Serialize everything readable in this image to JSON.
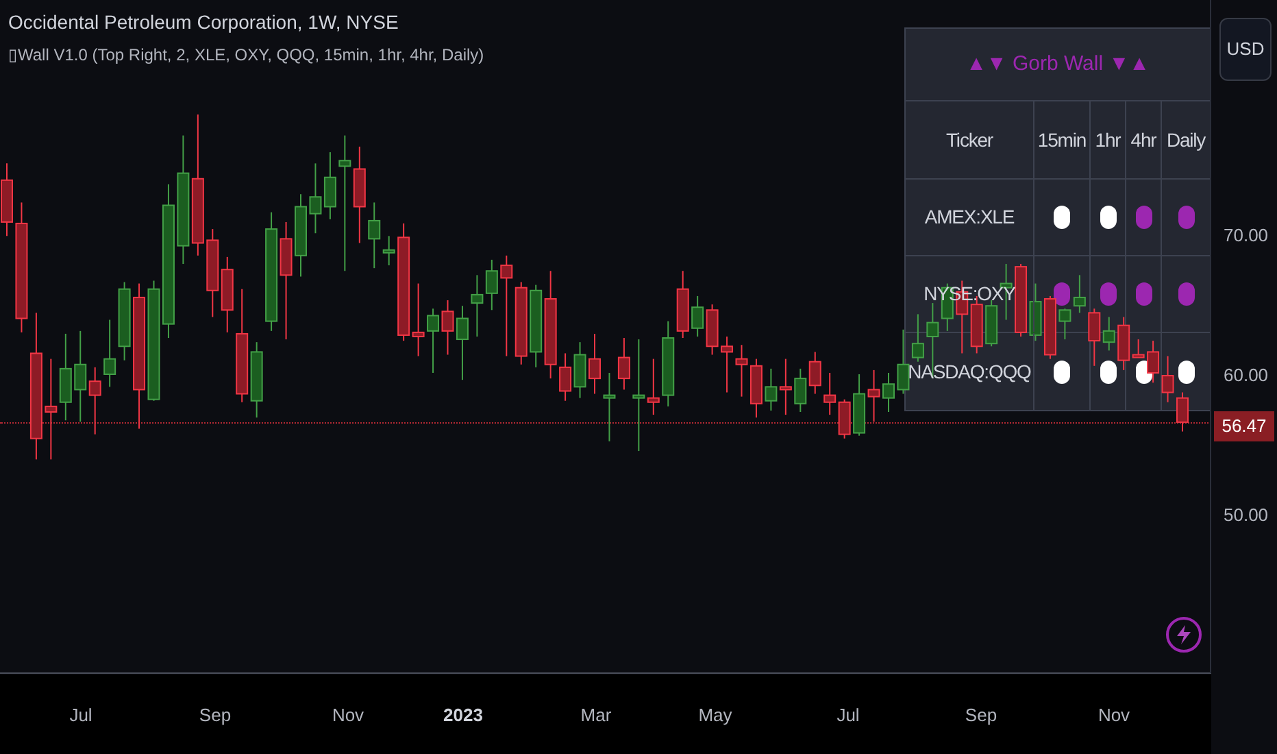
{
  "header": {
    "title": "Occidental Petroleum Corporation, 1W, NYSE",
    "indicator": "▯Wall V1.0 (Top Right, 2, XLE, OXY, QQQ, 15min, 1hr, 4hr, Daily)"
  },
  "currency_button": "USD",
  "price_chart": {
    "last_price": "56.47",
    "chart_data": {
      "type": "candlestick",
      "ylim": [
        38.5,
        86.7
      ],
      "yticks": [
        {
          "value": 70,
          "label": "70.00"
        },
        {
          "value": 60,
          "label": "60.00"
        },
        {
          "value": 50,
          "label": "50.00"
        }
      ],
      "ohlc": [
        [
          73.8,
          75.0,
          69.8,
          70.8
        ],
        [
          70.7,
          72.2,
          62.9,
          63.9
        ],
        [
          61.4,
          64.3,
          53.8,
          55.3
        ],
        [
          57.6,
          61.0,
          53.8,
          57.2
        ],
        [
          57.9,
          62.8,
          56.6,
          60.3
        ],
        [
          58.8,
          63.0,
          56.5,
          60.6
        ],
        [
          59.4,
          60.4,
          55.6,
          58.4
        ],
        [
          59.9,
          63.8,
          59.0,
          61.0
        ],
        [
          61.9,
          66.5,
          60.9,
          66.0
        ],
        [
          65.4,
          66.4,
          56.0,
          58.8
        ],
        [
          58.1,
          66.6,
          58.0,
          66.0
        ],
        [
          63.5,
          73.5,
          62.5,
          72.0
        ],
        [
          69.1,
          77.0,
          67.8,
          74.3
        ],
        [
          73.9,
          78.5,
          68.4,
          69.3
        ],
        [
          69.5,
          70.3,
          64.0,
          65.9
        ],
        [
          67.4,
          68.3,
          62.9,
          64.5
        ],
        [
          62.8,
          66.0,
          57.9,
          58.5
        ],
        [
          58.0,
          62.2,
          56.8,
          61.5
        ],
        [
          63.7,
          71.5,
          63.0,
          70.3
        ],
        [
          69.6,
          70.8,
          62.4,
          67.0
        ],
        [
          68.4,
          72.8,
          66.9,
          71.9
        ],
        [
          71.4,
          75.0,
          70.0,
          72.6
        ],
        [
          71.9,
          75.8,
          71.0,
          74.0
        ],
        [
          74.8,
          77.0,
          67.3,
          75.2
        ],
        [
          74.6,
          76.2,
          69.3,
          71.9
        ],
        [
          69.6,
          72.2,
          67.5,
          70.9
        ],
        [
          68.6,
          69.8,
          67.7,
          68.8
        ],
        [
          69.7,
          70.7,
          62.3,
          62.7
        ],
        [
          62.9,
          66.4,
          61.2,
          62.6
        ],
        [
          63.0,
          64.6,
          60.0,
          64.1
        ],
        [
          64.4,
          65.2,
          61.3,
          63.0
        ],
        [
          62.4,
          64.8,
          59.5,
          63.9
        ],
        [
          65.0,
          67.0,
          62.6,
          65.6
        ],
        [
          65.7,
          68.1,
          64.5,
          67.3
        ],
        [
          67.7,
          68.4,
          61.2,
          66.8
        ],
        [
          66.1,
          66.5,
          60.6,
          61.2
        ],
        [
          61.5,
          66.3,
          60.4,
          65.9
        ],
        [
          65.3,
          67.3,
          59.6,
          60.6
        ],
        [
          60.4,
          61.4,
          58.0,
          58.7
        ],
        [
          59.0,
          62.2,
          58.2,
          61.3
        ],
        [
          61.0,
          62.8,
          58.5,
          59.6
        ],
        [
          58.2,
          60.0,
          55.1,
          58.4
        ],
        [
          61.1,
          62.5,
          58.8,
          59.6
        ],
        [
          58.2,
          62.4,
          54.4,
          58.4
        ],
        [
          58.2,
          61.0,
          57.0,
          57.9
        ],
        [
          58.4,
          63.7,
          57.6,
          62.5
        ],
        [
          66.0,
          67.3,
          62.5,
          63.0
        ],
        [
          63.2,
          65.5,
          62.6,
          64.7
        ],
        [
          64.5,
          64.9,
          61.3,
          61.9
        ],
        [
          61.9,
          62.6,
          58.6,
          61.5
        ],
        [
          61.0,
          62.0,
          58.3,
          60.6
        ],
        [
          60.5,
          61.0,
          56.8,
          57.8
        ],
        [
          58.0,
          60.3,
          57.3,
          59.0
        ],
        [
          59.0,
          61.0,
          57.0,
          58.8
        ],
        [
          57.8,
          60.3,
          57.2,
          59.6
        ],
        [
          60.8,
          61.5,
          58.5,
          59.1
        ],
        [
          58.4,
          60.0,
          57.0,
          57.9
        ],
        [
          57.9,
          58.1,
          55.3,
          55.6
        ],
        [
          55.7,
          59.9,
          55.5,
          58.5
        ],
        [
          58.8,
          60.2,
          56.5,
          58.3
        ],
        [
          58.2,
          60.0,
          57.2,
          59.2
        ],
        [
          58.8,
          63.1,
          58.5,
          60.6
        ],
        [
          61.1,
          64.2,
          60.8,
          62.1
        ],
        [
          62.6,
          65.0,
          59.6,
          63.6
        ],
        [
          63.9,
          66.4,
          63.0,
          66.1
        ],
        [
          65.8,
          66.6,
          61.4,
          64.2
        ],
        [
          64.9,
          65.5,
          61.4,
          61.9
        ],
        [
          62.1,
          65.2,
          61.9,
          64.8
        ],
        [
          66.1,
          67.8,
          63.8,
          66.4
        ],
        [
          67.6,
          67.8,
          62.6,
          62.9
        ],
        [
          62.7,
          66.4,
          62.3,
          65.1
        ],
        [
          65.3,
          65.5,
          61.0,
          61.3
        ],
        [
          63.7,
          64.6,
          62.4,
          64.5
        ],
        [
          64.8,
          67.0,
          64.3,
          65.4
        ],
        [
          64.3,
          64.6,
          60.5,
          62.3
        ],
        [
          62.2,
          64.0,
          61.6,
          63.0
        ],
        [
          63.4,
          64.0,
          60.2,
          60.9
        ],
        [
          61.3,
          62.4,
          61.1,
          61.2
        ],
        [
          61.5,
          62.3,
          59.3,
          60.0
        ],
        [
          59.8,
          61.2,
          57.9,
          58.6
        ],
        [
          58.2,
          58.6,
          55.8,
          56.47
        ]
      ]
    }
  },
  "time_axis": [
    {
      "label": "Jul",
      "bold": false
    },
    {
      "label": "Sep",
      "bold": false
    },
    {
      "label": "Nov",
      "bold": false
    },
    {
      "label": "2023",
      "bold": true
    },
    {
      "label": "Mar",
      "bold": false
    },
    {
      "label": "May",
      "bold": false
    },
    {
      "label": "Jul",
      "bold": false
    },
    {
      "label": "Sep",
      "bold": false
    },
    {
      "label": "Nov",
      "bold": false
    }
  ],
  "table": {
    "title": "▲▼ Gorb Wall ▼▲",
    "columns": [
      "Ticker",
      "15min",
      "1hr",
      "4hr",
      "Daily"
    ],
    "rows": [
      {
        "ticker": "AMEX:XLE",
        "signals": [
          {
            "color": "#ffffff"
          },
          {
            "color": "#ffffff"
          },
          {
            "color": "#9c27b0"
          },
          {
            "color": "#9c27b0"
          }
        ]
      },
      {
        "ticker": "NYSE:OXY",
        "signals": [
          {
            "color": "#9c27b0"
          },
          {
            "color": "#9c27b0"
          },
          {
            "color": "#9c27b0"
          },
          {
            "color": "#9c27b0"
          }
        ]
      },
      {
        "ticker": "NASDAQ:QQQ",
        "signals": [
          {
            "color": "#ffffff"
          },
          {
            "color": "#ffffff"
          },
          {
            "color": "#ffffff"
          },
          {
            "color": "#ffffff"
          }
        ]
      }
    ]
  }
}
